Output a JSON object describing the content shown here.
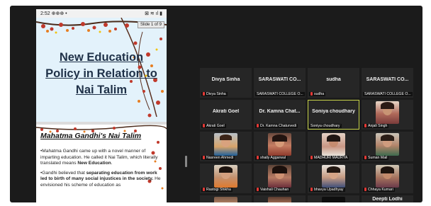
{
  "phone_status": {
    "time": "2:52",
    "icons_left": "⊕⊕⊕ •",
    "icons_right": "⊠ ≋ ıl ▮"
  },
  "slide1": {
    "counter": "Slide 1 of 9",
    "title_lines": [
      "New Education",
      "Policy in Relation to",
      "Nai Talim"
    ]
  },
  "slide2": {
    "heading": "Mahatma Gandhi's Nai Talim",
    "p1": "•Mahatma Gandhi came up with a novel manner of imparting education. He called it Nai Talim, which literally translated means ",
    "p1_bold": "New Education",
    "p1_end": ".",
    "p2": "•Gandhi believed that ",
    "p2_bold": "separating education from work led to birth of many social injustices in the society.",
    "p2_end": " He envisioned his scheme of education as"
  },
  "participants": [
    {
      "name": "Divya Sinha",
      "label": "Divya Sinha",
      "tile": "Divya Sinha"
    },
    {
      "name": "SARASWATI CO...",
      "label": "SARASWATI COLLEGE O...",
      "tile": "SARASWATI CO..."
    },
    {
      "name": "sudha",
      "label": "sudha",
      "tile": "sudha"
    },
    {
      "name": "SARASWATI CO...",
      "label": "SARASWATI COLLEGE O...",
      "tile": "SARASWATI CO..."
    },
    {
      "name": "Akrati Goel",
      "label": "Akrati Goel",
      "tile": "Akrati Goel"
    },
    {
      "name": "Dr. Kamna Chat...",
      "label": "Dr. Kamna Chaturvedi",
      "tile": "Dr. Kamna Chat..."
    },
    {
      "name": "Soniya choudhary",
      "label": "Soniya choudhary",
      "tile": "Soniya choudhary"
    },
    {
      "name": "Anjali Singh",
      "label": "Anjali Singh",
      "tile": ""
    },
    {
      "name": "Nasreen Ahmedi",
      "label": "Nasreen Ahmedi",
      "tile": ""
    },
    {
      "name": "shaily Aggarwal",
      "label": "shaily Aggarwal",
      "tile": ""
    },
    {
      "name": "MADHURI MAURYA",
      "label": "MADHURI MAURYA",
      "tile": ""
    },
    {
      "name": "Suman Mail",
      "label": "Suman Mail",
      "tile": ""
    },
    {
      "name": "Rastogi Shikha",
      "label": "Rastogi Shikha",
      "tile": ""
    },
    {
      "name": "Vaishali Chauhan",
      "label": "Vaishali Chauhan",
      "tile": ""
    },
    {
      "name": "bhavya Upadhyay",
      "label": "bhavya Upadhyay",
      "tile": ""
    },
    {
      "name": "Chhaya Kumari",
      "label": "Chhaya Kumari",
      "tile": ""
    },
    {
      "name": "",
      "label": "",
      "tile": ""
    },
    {
      "name": "",
      "label": "",
      "tile": ""
    },
    {
      "name": "",
      "label": "",
      "tile": ""
    },
    {
      "name": "Deepti Lodhi",
      "label": "",
      "tile": "Deepti Lodhi"
    }
  ],
  "colors": {
    "window_bg": "#1b1b1b",
    "tile_bg": "#262626",
    "active_speaker": "#c8d44a",
    "muted_mic": "#e53935",
    "slide_title": "#1f3148"
  }
}
